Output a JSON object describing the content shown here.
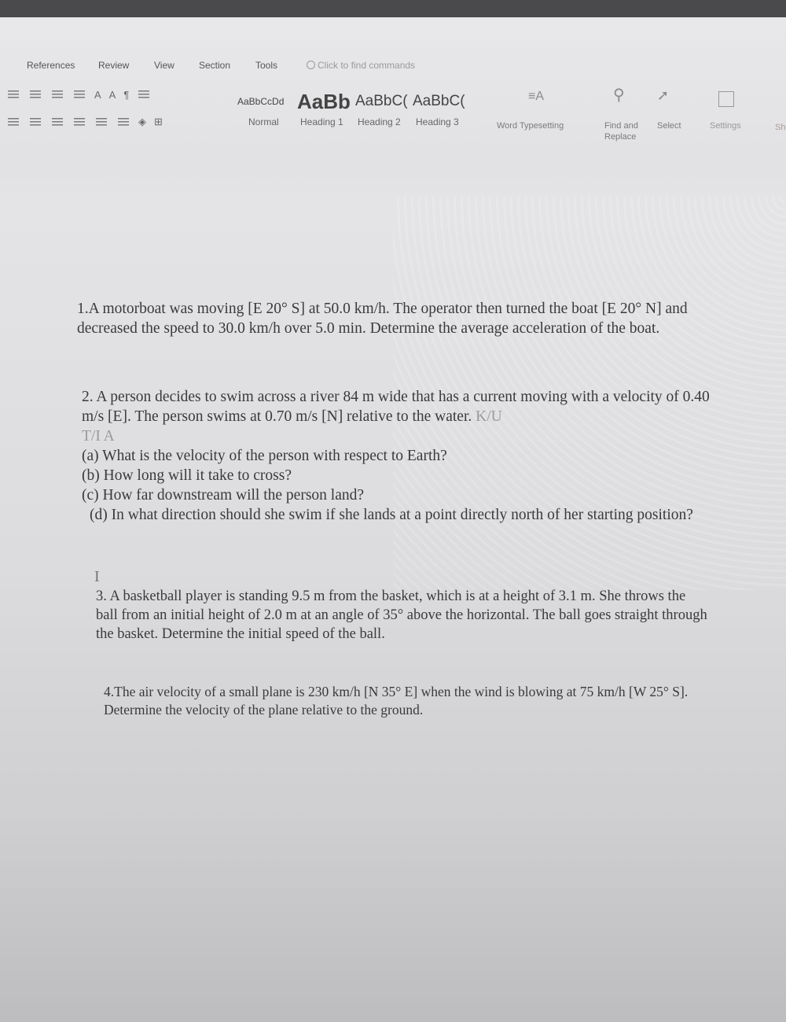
{
  "menu": {
    "items": [
      "References",
      "Review",
      "View",
      "Section",
      "Tools"
    ],
    "search_placeholder": "Click to find commands"
  },
  "styles": {
    "previews": [
      "AaBbCcDd",
      "AaBb",
      "AaBbC(",
      "AaBbC("
    ],
    "labels": [
      "Normal",
      "Heading 1",
      "Heading 2",
      "Heading 3"
    ]
  },
  "tools": {
    "word_typesetting": "Word Typesetting",
    "find_replace_1": "Find and",
    "find_replace_2": "Replace",
    "select": "Select",
    "settings": "Settings",
    "cut_off": "Sh"
  },
  "document": {
    "q1": "1.A motorboat was moving [E 20° S] at 50.0 km/h. The operator then turned the boat [E 20° N] and decreased the speed to 30.0 km/h over 5.0 min. Determine the average acceleration of the boat.",
    "q2_text": "2. A person decides to swim across a river 84 m wide that has a current moving with a velocity of 0.40 m/s [E]. The person swims at 0.70 m/s [N] relative to the water.",
    "q2_tag1": "K/U",
    "q2_tag2": "T/I A",
    "q2_a": "(a) What is the velocity of the person with respect to Earth?",
    "q2_b": "(b) How long will it take to cross?",
    "q2_c": "(c) How far downstream will the person land?",
    "q2_d": "(d) In what direction should she swim if she lands at a point directly north of her starting position?",
    "q3": "3. A basketball player is standing 9.5 m from the basket, which is at a height of 3.1 m. She throws the ball from an initial height of 2.0 m at an angle of 35° above the horizontal. The ball goes straight through the basket. Determine the initial speed of the ball.",
    "q4": "4.The air velocity of a small plane is 230 km/h [N 35° E] when the wind is blowing at 75 km/h [W 25° S]. Determine the velocity of the plane relative to the ground."
  }
}
